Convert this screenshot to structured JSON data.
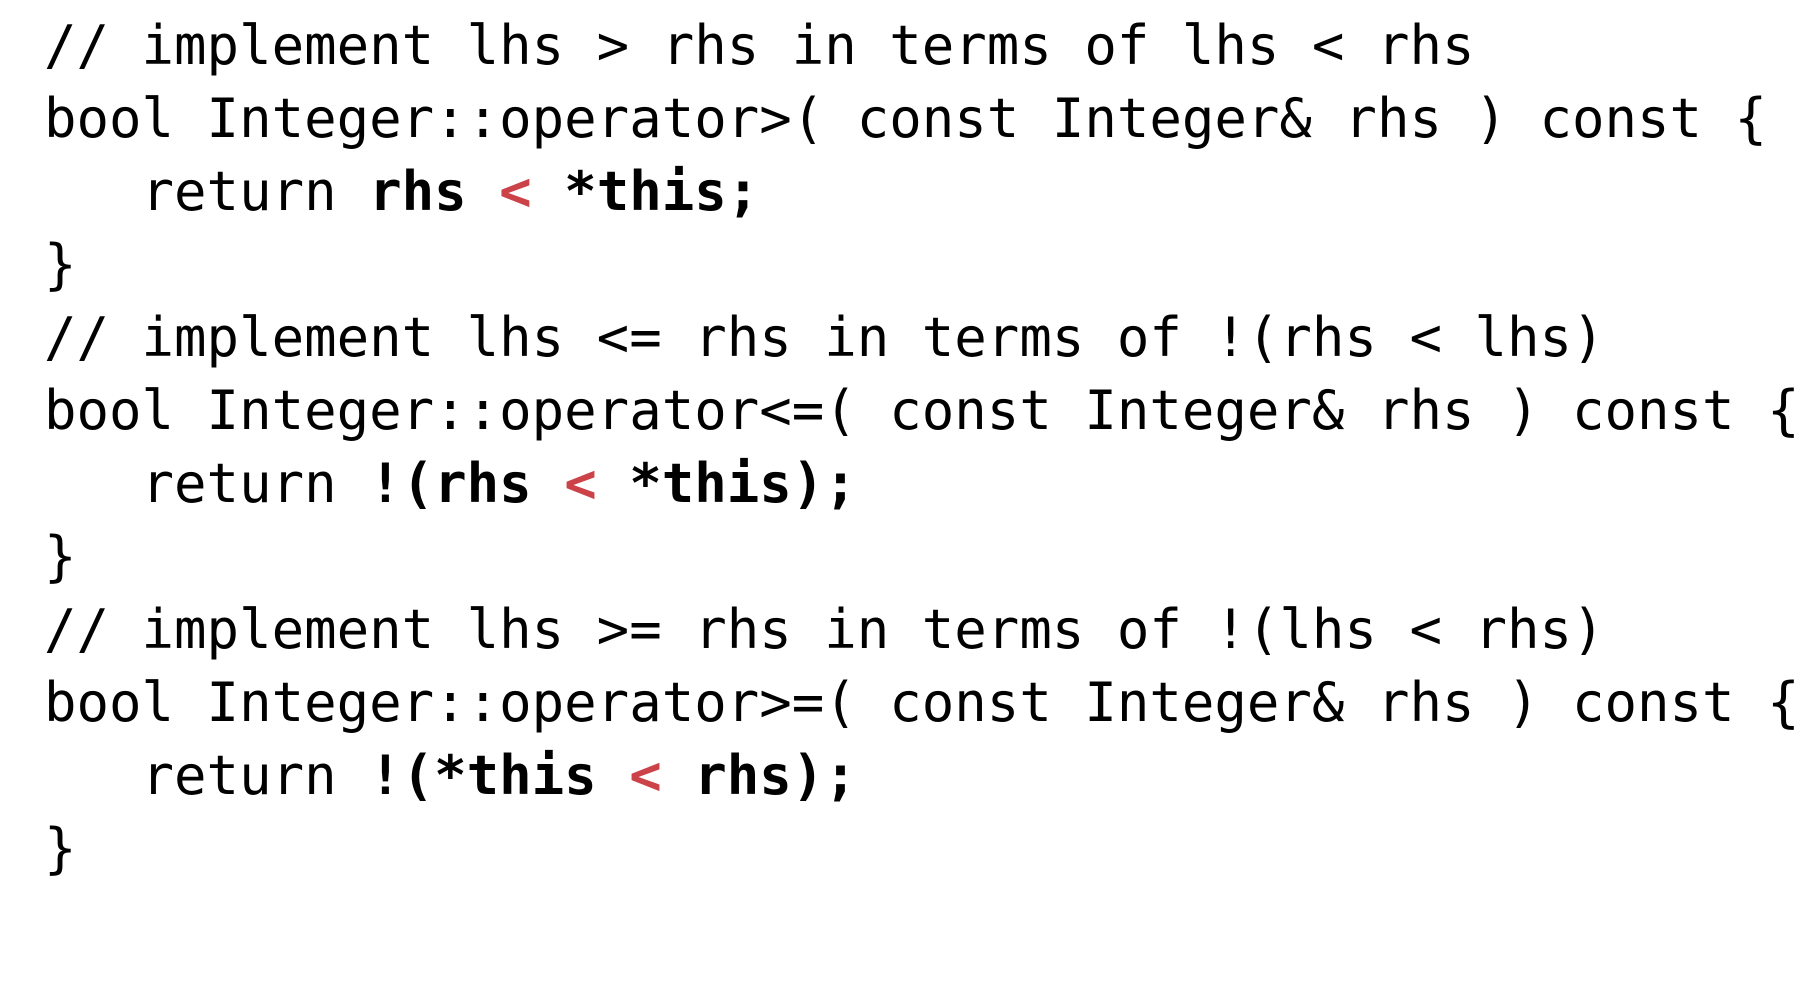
{
  "slide": {
    "kind": "code-listing",
    "language": "cpp",
    "background_color": "#ffffff",
    "text_color": "#000000",
    "highlight_color": "#cb4248",
    "font_size_px": 54,
    "line_height_px": 73
  },
  "code": {
    "lines": [
      {
        "id": "line-1",
        "text": "// implement lhs > rhs in terms of lhs < rhs",
        "segments": [
          {
            "text": "// implement lhs > rhs in terms of lhs < rhs",
            "style": "plain"
          }
        ]
      },
      {
        "id": "line-2",
        "text": "bool Integer::operator>( const Integer& rhs ) const {",
        "segments": [
          {
            "text": "bool Integer::operator>( const Integer& rhs ) const {",
            "style": "plain"
          }
        ]
      },
      {
        "id": "line-3",
        "text": "   return rhs < *this;",
        "segments": [
          {
            "text": "   return ",
            "style": "plain"
          },
          {
            "text": "rhs ",
            "style": "strong"
          },
          {
            "text": "<",
            "style": "op"
          },
          {
            "text": " *this;",
            "style": "strong"
          }
        ]
      },
      {
        "id": "line-4",
        "text": "}",
        "segments": [
          {
            "text": "}",
            "style": "plain"
          }
        ]
      },
      {
        "id": "line-5",
        "text": "// implement lhs <= rhs in terms of !(rhs < lhs)",
        "segments": [
          {
            "text": "// implement lhs <= rhs in terms of !(rhs < lhs)",
            "style": "plain"
          }
        ]
      },
      {
        "id": "line-6",
        "text": "bool Integer::operator<=( const Integer& rhs ) const {",
        "segments": [
          {
            "text": "bool Integer::operator<=( const Integer& rhs ) const {",
            "style": "plain"
          }
        ]
      },
      {
        "id": "line-7",
        "text": "   return !(rhs < *this);",
        "segments": [
          {
            "text": "   return ",
            "style": "plain"
          },
          {
            "text": "!(rhs ",
            "style": "strong"
          },
          {
            "text": "<",
            "style": "op"
          },
          {
            "text": " *this);",
            "style": "strong"
          }
        ]
      },
      {
        "id": "line-8",
        "text": "}",
        "segments": [
          {
            "text": "}",
            "style": "plain"
          }
        ]
      },
      {
        "id": "line-9",
        "text": "// implement lhs >= rhs in terms of !(lhs < rhs)",
        "segments": [
          {
            "text": "// implement lhs >= rhs in terms of !(lhs < rhs)",
            "style": "plain"
          }
        ]
      },
      {
        "id": "line-10",
        "text": "bool Integer::operator>=( const Integer& rhs ) const {",
        "segments": [
          {
            "text": "bool Integer::operator>=( const Integer& rhs ) const {",
            "style": "plain"
          }
        ]
      },
      {
        "id": "line-11",
        "text": "   return !(*this < rhs);",
        "segments": [
          {
            "text": "   return ",
            "style": "plain"
          },
          {
            "text": "!(*this ",
            "style": "strong"
          },
          {
            "text": "<",
            "style": "op"
          },
          {
            "text": " rhs);",
            "style": "strong"
          }
        ]
      },
      {
        "id": "line-12",
        "text": "}",
        "segments": [
          {
            "text": "}",
            "style": "plain"
          }
        ]
      }
    ]
  }
}
